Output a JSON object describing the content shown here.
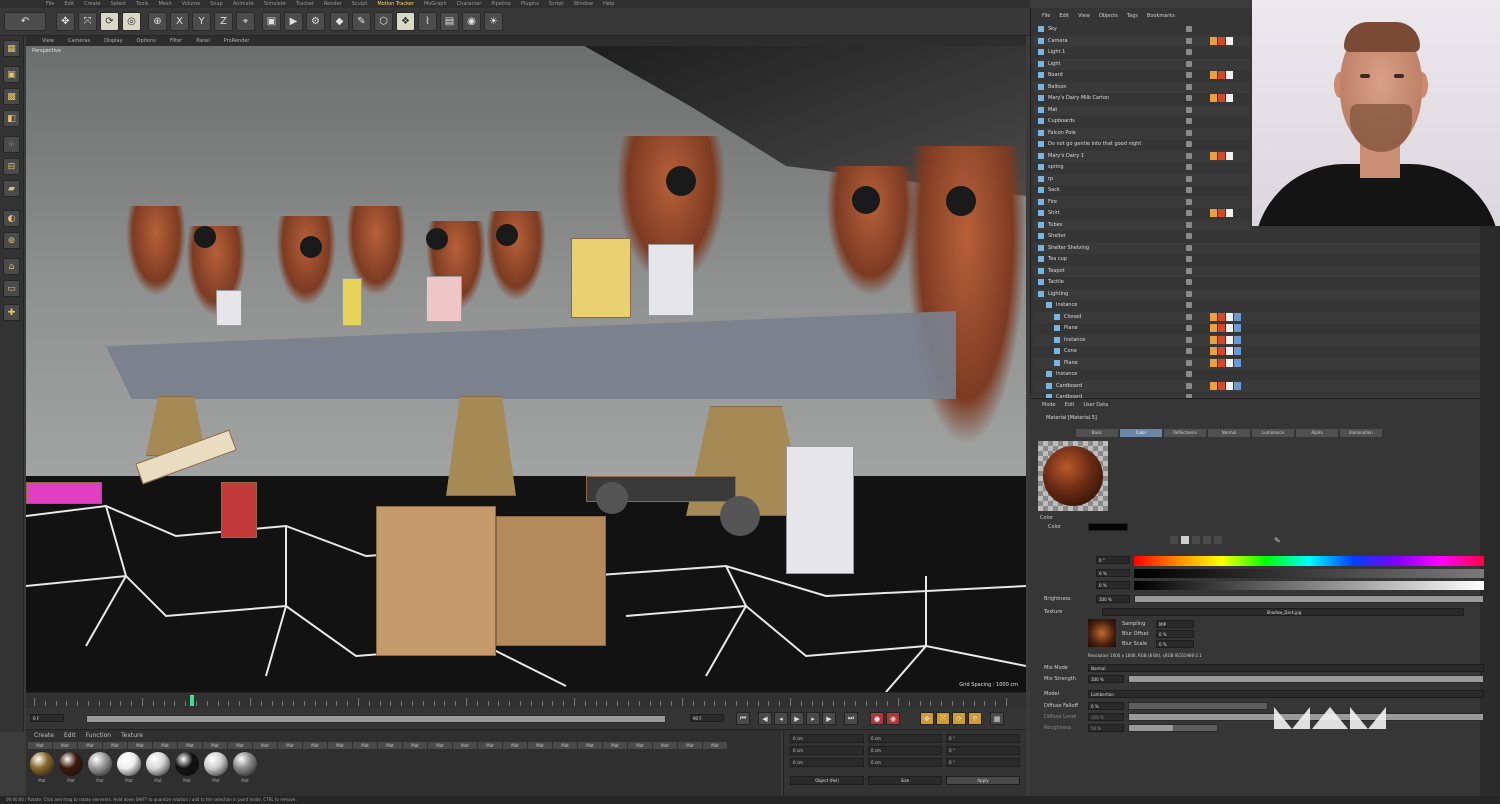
{
  "menubar": {
    "items": [
      "File",
      "Edit",
      "Create",
      "Select",
      "Tools",
      "Mesh",
      "Volume",
      "Snap",
      "Animate",
      "Simulate",
      "Tracker",
      "Render",
      "Sculpt",
      "Motion Tracker",
      "MoGraph",
      "Character",
      "Pipeline",
      "Plugins",
      "Script",
      "Window",
      "Help"
    ],
    "highlighted": "Motion Tracker"
  },
  "toolbar": {
    "undo_icon": "undo-icon",
    "tools": [
      "move-icon",
      "scale-icon",
      "rotate-icon",
      "live-select-icon",
      "x-axis-icon",
      "y-axis-icon",
      "z-axis-icon",
      "world-coord-icon",
      "render-view-icon",
      "render-settings-icon",
      "cube-icon",
      "pen-icon",
      "subdivision-icon",
      "cloner-icon",
      "deformer-icon",
      "scene-icon",
      "light-icon",
      "camera-icon"
    ]
  },
  "viewport": {
    "menu": [
      "View",
      "Cameras",
      "Display",
      "Options",
      "Filter",
      "Panel",
      "ProRender"
    ],
    "label": "Perspective",
    "grid_label": "Grid Spacing : 1000 cm"
  },
  "timeline": {
    "current_frame": "13",
    "start_field": "0 F",
    "end_field": "90 F",
    "frame_field": "90 F"
  },
  "material_manager": {
    "menu": [
      "Create",
      "Edit",
      "Function",
      "Texture"
    ],
    "materials": [
      {
        "label": "Mat",
        "color": "#8a6a2a"
      },
      {
        "label": "Mat",
        "color": "#3a1a0a"
      },
      {
        "label": "Mat",
        "color": "#9a9a9a"
      },
      {
        "label": "Mat",
        "color": "#f0f0f0"
      },
      {
        "label": "Mat",
        "color": "#d8d8d8"
      },
      {
        "label": "Mat",
        "color": "#111111"
      },
      {
        "label": "Mat",
        "color": "#cfcfcf"
      },
      {
        "label": "Mat",
        "color": "#8a8a8a"
      }
    ],
    "material_labels_row": [
      "Mat",
      "Mat",
      "Mat",
      "Mat",
      "Mat",
      "Mat",
      "Mat",
      "Mat",
      "Mat",
      "Mat",
      "Mat",
      "Mat",
      "Mat",
      "Mat",
      "Mat",
      "Mat",
      "Mat",
      "Mat",
      "Mat",
      "Mat",
      "Mat",
      "Mat",
      "Mat",
      "Mat",
      "Mat",
      "Mat",
      "Mat",
      "Mat"
    ]
  },
  "coordinates": {
    "rows": [
      [
        "X",
        "0 cm",
        "X",
        "0 cm",
        "H",
        "0 °"
      ],
      [
        "Y",
        "0 cm",
        "Y",
        "0 cm",
        "P",
        "0 °"
      ],
      [
        "Z",
        "0 cm",
        "Z",
        "0 cm",
        "B",
        "0 °"
      ]
    ],
    "mode": "Object (Rel)",
    "size_mode": "Size",
    "apply_button": "Apply"
  },
  "object_manager": {
    "menu": [
      "File",
      "Edit",
      "View",
      "Objects",
      "Tags",
      "Bookmarks"
    ],
    "objects": [
      {
        "name": "Sky",
        "indent": 0
      },
      {
        "name": "Camera",
        "indent": 0
      },
      {
        "name": "Light.1",
        "indent": 0
      },
      {
        "name": "Light",
        "indent": 0
      },
      {
        "name": "Board",
        "indent": 0
      },
      {
        "name": "Balloon",
        "indent": 0
      },
      {
        "name": "Mary's Dairy Milk Carton",
        "indent": 0
      },
      {
        "name": "Mat",
        "indent": 0
      },
      {
        "name": "Cupboards",
        "indent": 0
      },
      {
        "name": "Falcon Pole",
        "indent": 0
      },
      {
        "name": "Do not go gentle into that good night",
        "indent": 0
      },
      {
        "name": "Mary's Dairy 1",
        "indent": 0
      },
      {
        "name": "spring",
        "indent": 0
      },
      {
        "name": "rp",
        "indent": 0
      },
      {
        "name": "Sack",
        "indent": 0
      },
      {
        "name": "Fire",
        "indent": 0
      },
      {
        "name": "Shirt",
        "indent": 0
      },
      {
        "name": "Tubes",
        "indent": 0
      },
      {
        "name": "Shelter",
        "indent": 0
      },
      {
        "name": "Shelter Shelving",
        "indent": 0
      },
      {
        "name": "Tea cup",
        "indent": 0
      },
      {
        "name": "Teapot",
        "indent": 0
      },
      {
        "name": "Tactile",
        "indent": 0
      },
      {
        "name": "Lighting",
        "indent": 0
      },
      {
        "name": "Instance",
        "indent": 1
      },
      {
        "name": "Cloned",
        "indent": 2
      },
      {
        "name": "Plane",
        "indent": 2
      },
      {
        "name": "Instance",
        "indent": 2
      },
      {
        "name": "Cone",
        "indent": 2
      },
      {
        "name": "Plane",
        "indent": 2
      },
      {
        "name": "Instance",
        "indent": 1
      },
      {
        "name": "Cardboard",
        "indent": 1
      },
      {
        "name": "Cardboard",
        "indent": 1
      }
    ]
  },
  "attribute_manager": {
    "menu": [
      "Mode",
      "Edit",
      "User Data"
    ],
    "title": "Material [Material.5]",
    "tabs": [
      "Basic",
      "Color",
      "Reflectance",
      "Normal",
      "Luminance",
      "Alpha",
      "Illumination"
    ],
    "active_tab": "Color",
    "section": "Color",
    "color_label": "Color",
    "color_fields": [
      "0 °",
      "0 %",
      "0 %"
    ],
    "brightness_label": "Brightness",
    "brightness_value": "100 %",
    "texture_label": "Texture",
    "texture_file": "Shadow_Dark.jpg",
    "sampling_label": "Sampling",
    "sampling_value": "MIP",
    "blur_offset_label": "Blur Offset",
    "blur_offset_value": "0 %",
    "blur_scale_label": "Blur Scale",
    "blur_scale_value": "0 %",
    "resolution_text": "Resolution 1600 x 1600, RGB (8 Bit), sRGB IEC61966-2.1",
    "mix_mode_label": "Mix Mode",
    "mix_mode_value": "Normal",
    "mix_strength_label": "Mix Strength",
    "mix_strength_value": "100 %",
    "model_label": "Model",
    "model_value": "Lambertian",
    "diffuse_falloff_label": "Diffuse Falloff",
    "diffuse_falloff_value": "0 %",
    "diffuse_level_label": "Diffuse Level",
    "diffuse_level_value": "100 %",
    "roughness_label": "Roughness",
    "roughness_value": "50 %"
  },
  "status_bar": "00:00:00 / Rotate: Click and drag to rotate elements. Hold down SHIFT to quantize rotation / add to the selection in point mode. CTRL to remove.",
  "colors": {
    "accent": "#6b86a6",
    "record": "#b2353c",
    "keyframe": "#d39a2c",
    "timeline_marker": "#3de08d"
  }
}
